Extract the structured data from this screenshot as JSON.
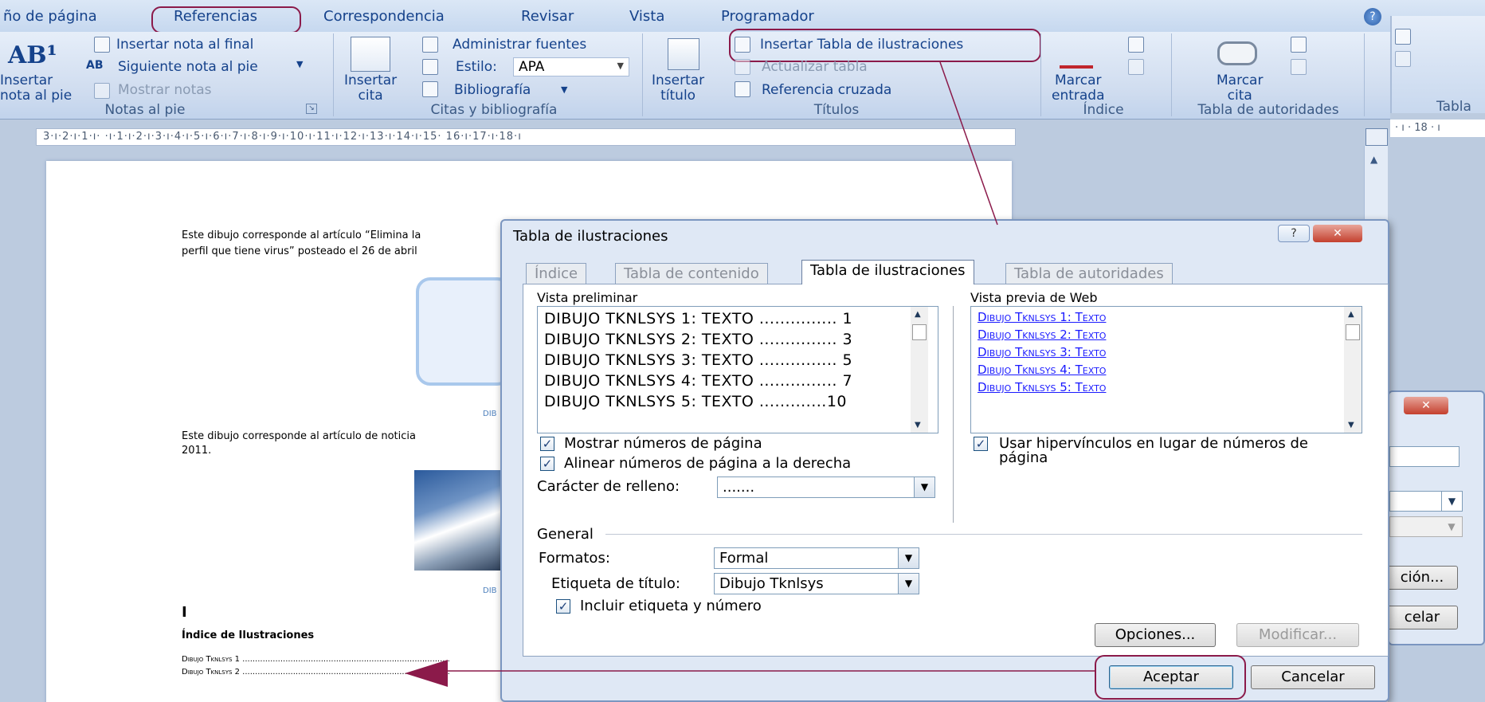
{
  "tabs": {
    "items": [
      "ño de página",
      "Referencias",
      "Correspondencia",
      "Revisar",
      "Vista",
      "Programador"
    ]
  },
  "ribbon": {
    "notas": {
      "insertar_label": "Insertar\nnota al pie",
      "ab_glyph": "AB¹",
      "nota_final": "Insertar nota al final",
      "siguiente": "Siguiente nota al pie",
      "mostrar": "Mostrar notas",
      "group": "Notas al pie"
    },
    "citas": {
      "insertar_cita": "Insertar\ncita",
      "administrar": "Administrar fuentes",
      "estilo_label": "Estilo:",
      "estilo_value": "APA",
      "bibliografia": "Bibliografía",
      "group": "Citas y bibliografía"
    },
    "titulos": {
      "insertar_titulo": "Insertar\ntítulo",
      "tabla_ilustraciones": "Insertar Tabla de ilustraciones",
      "actualizar": "Actualizar tabla",
      "ref_cruzada": "Referencia cruzada",
      "group": "Títulos"
    },
    "indice": {
      "marcar_entrada": "Marcar\nentrada",
      "group": "Índice"
    },
    "autoridades": {
      "marcar_cita": "Marcar\ncita",
      "group": "Tabla de autoridades"
    },
    "extra": {
      "group": "Tabla"
    }
  },
  "ruler": {
    "text": "3·ı·2·ı·1·ı·  ·ı·1·ı·2·ı·3·ı·4·ı·5·ı·6·ı·7·ı·8·ı·9·ı·10·ı·11·ı·12·ı·13·ı·14·ı·15· 16·ı·17·ı·18·ı",
    "right_text": "· ı · 18 · ı"
  },
  "document": {
    "para1_l1": "Este dibujo corresponde al artículo “Elimina la",
    "para1_l2": "perfil que tiene virus” posteado  el 26 de abril",
    "cap1": "DIB",
    "para2_l1": "Este dibujo corresponde al artículo de noticia",
    "para2_l2": "2011.",
    "cap2": "DIB",
    "cursor": "I",
    "indice_title": "Índice de Ilustraciones",
    "entry1": "Dibujo Tknlsys 1 ..................................................................................",
    "entry2": "Dibujo Tknlsys 2 .................................................................................."
  },
  "dialog": {
    "title": "Tabla de ilustraciones",
    "help": "?",
    "close": "✕",
    "tabs": [
      "Índice",
      "Tabla de contenido",
      "Tabla de ilustraciones",
      "Tabla de autoridades"
    ],
    "vista_preliminar": "Vista preliminar",
    "preview": [
      "DIBUJO TKNLSYS 1: TEXTO ............... 1",
      "DIBUJO TKNLSYS 2: TEXTO ............... 3",
      "DIBUJO TKNLSYS 3: TEXTO ............... 5",
      "DIBUJO TKNLSYS 4: TEXTO ............... 7",
      "DIBUJO TKNLSYS 5: TEXTO .............10"
    ],
    "vista_web": "Vista previa de Web",
    "web": [
      "Dibujo Tknlsys 1: Texto",
      "Dibujo Tknlsys 2: Texto",
      "Dibujo Tknlsys 3: Texto",
      "Dibujo Tknlsys 4: Texto",
      "Dibujo Tknlsys 5: Texto"
    ],
    "mostrar_numeros": "Mostrar números de página",
    "alinear_numeros": "Alinear números de página a la derecha",
    "caracter_relleno_label": "Carácter de relleno:",
    "caracter_relleno_value": ".......",
    "usar_hipervinculos": "Usar hipervínculos en lugar de números de",
    "usar_hipervinculos_2": "página",
    "general": "General",
    "formatos_label": "Formatos:",
    "formatos_value": "Formal",
    "etiqueta_label": "Etiqueta de título:",
    "etiqueta_value": "Dibujo Tknlsys",
    "incluir": "Incluir etiqueta y número",
    "opciones": "Opciones...",
    "modificar": "Modificar...",
    "aceptar": "Aceptar",
    "cancelar": "Cancelar",
    "check": "✓"
  },
  "bg_dialog": {
    "btn1": "ción...",
    "btn2": "celar",
    "close": "✕"
  },
  "colors": {
    "annotation": "#8b1a4a",
    "link": "#1a1aff",
    "ribbon_text": "#15428b"
  }
}
